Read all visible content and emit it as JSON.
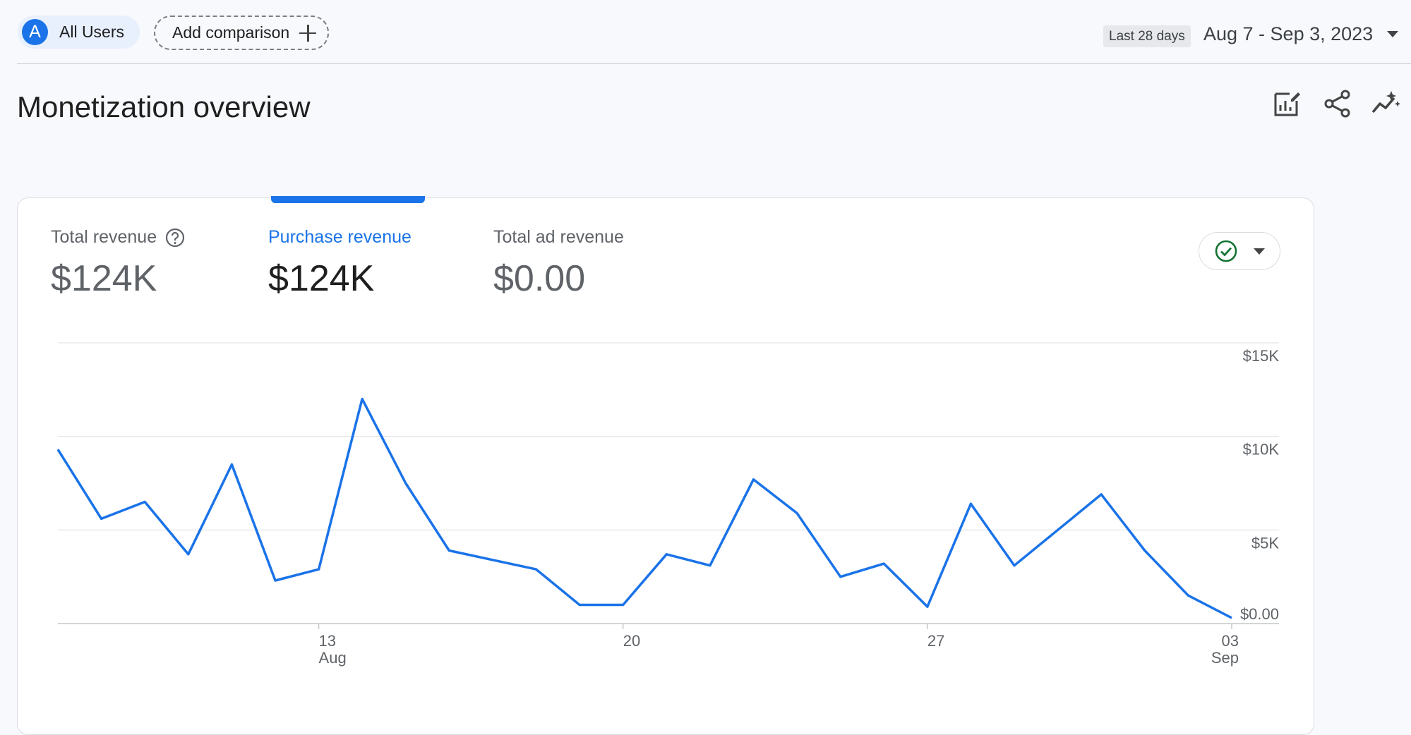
{
  "filters": {
    "segment": {
      "avatar_letter": "A",
      "label": "All Users"
    },
    "add_comparison_label": "Add comparison",
    "plus_icon": "plus-icon"
  },
  "date": {
    "preset": "Last 28 days",
    "range": "Aug 7 - Sep 3, 2023"
  },
  "header": {
    "title": "Monetization overview",
    "icons": [
      "edit-report-icon",
      "share-icon",
      "insights-icon"
    ]
  },
  "metrics": [
    {
      "label": "Total revenue",
      "value": "$124K",
      "help": true
    },
    {
      "label": "Purchase revenue",
      "value": "$124K",
      "active": true
    },
    {
      "label": "Total ad revenue",
      "value": "$0.00"
    }
  ],
  "colors": {
    "accent": "#1a73e8",
    "status_green": "#137333"
  },
  "chart_data": {
    "type": "line",
    "series": [
      {
        "name": "Purchase revenue",
        "x": [
          "Aug 7",
          "Aug 8",
          "Aug 9",
          "Aug 10",
          "Aug 11",
          "Aug 12",
          "Aug 13",
          "Aug 14",
          "Aug 15",
          "Aug 16",
          "Aug 17",
          "Aug 18",
          "Aug 19",
          "Aug 20",
          "Aug 21",
          "Aug 22",
          "Aug 23",
          "Aug 24",
          "Aug 25",
          "Aug 26",
          "Aug 27",
          "Aug 28",
          "Aug 29",
          "Aug 30",
          "Aug 31",
          "Sep 1",
          "Sep 2",
          "Sep 3"
        ],
        "values": [
          9300,
          5600,
          6500,
          3700,
          8500,
          2300,
          2900,
          12000,
          7500,
          3900,
          3400,
          2900,
          1000,
          1000,
          3700,
          3100,
          7700,
          5900,
          2500,
          3200,
          900,
          6400,
          3100,
          5000,
          6900,
          3900,
          1500,
          300
        ]
      }
    ],
    "y_ticks": [
      "$0.00",
      "$5K",
      "$10K",
      "$15K"
    ],
    "x_ticks": [
      {
        "day": "13",
        "month": "Aug"
      },
      {
        "day": "20",
        "month": ""
      },
      {
        "day": "27",
        "month": ""
      },
      {
        "day": "03",
        "month": "Sep"
      }
    ],
    "ylim": [
      0,
      15000
    ],
    "grid": true
  }
}
